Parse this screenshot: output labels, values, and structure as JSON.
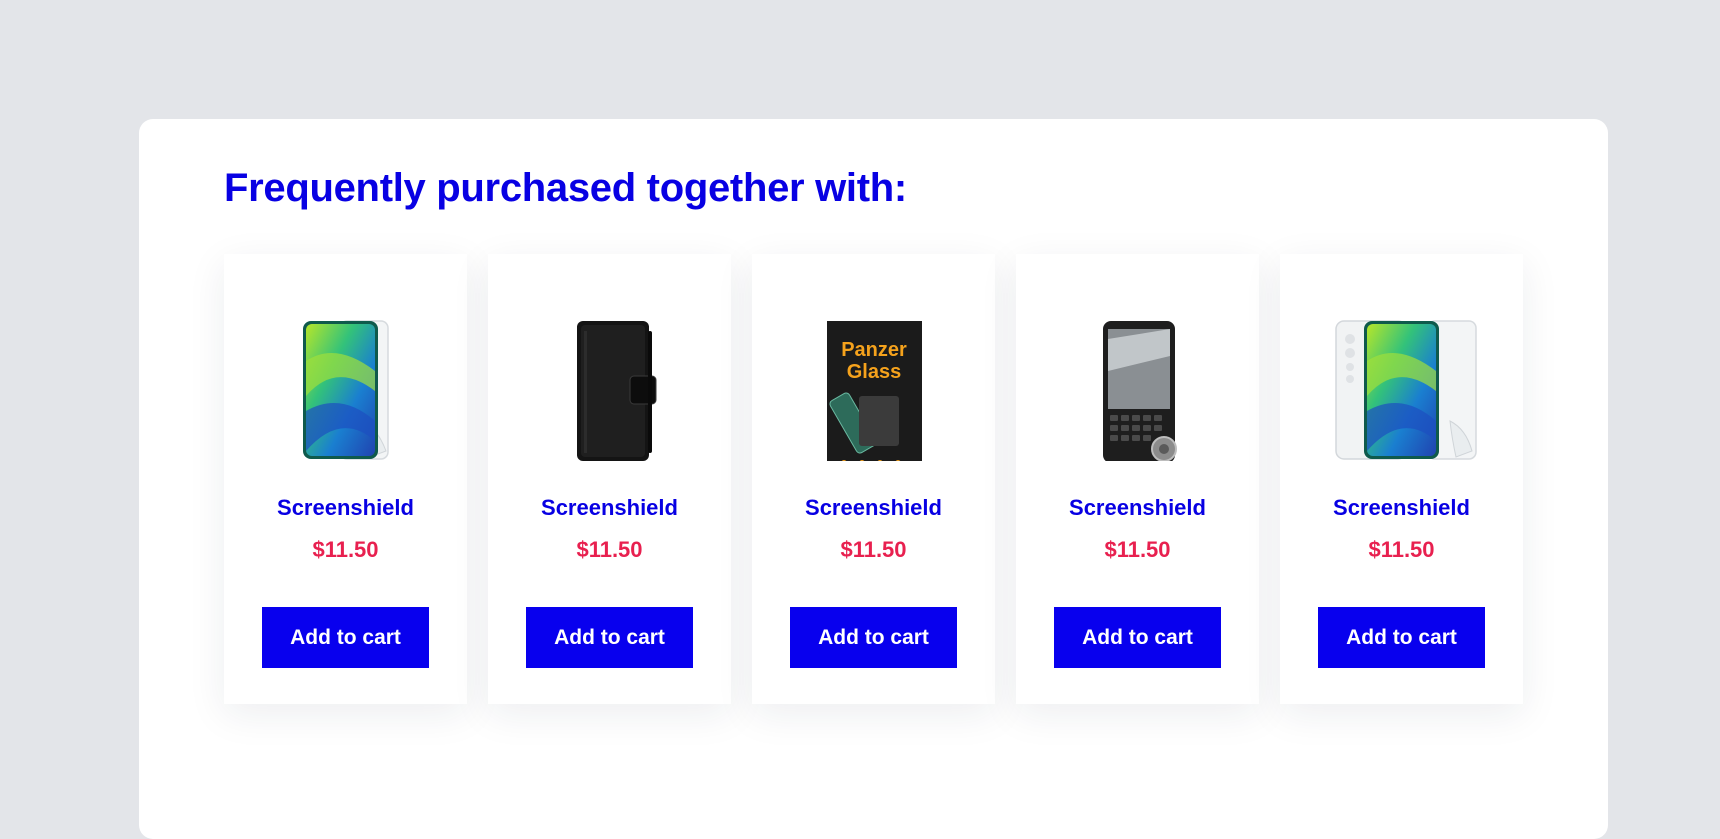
{
  "section": {
    "title": "Frequently purchased together with:"
  },
  "products": [
    {
      "name": "Screenshield",
      "price": "$11.50",
      "button_label": "Add to cart",
      "image": "phone-with-screen-protector-film"
    },
    {
      "name": "Screenshield",
      "price": "$11.50",
      "button_label": "Add to cart",
      "image": "black-flip-wallet-case"
    },
    {
      "name": "Screenshield",
      "price": "$11.50",
      "button_label": "Add to cart",
      "image": "panzerglass-package",
      "image_text": [
        "Panzer",
        "Glass"
      ]
    },
    {
      "name": "Screenshield",
      "price": "$11.50",
      "button_label": "Add to cart",
      "image": "keyboard-phone-with-protector"
    },
    {
      "name": "Screenshield",
      "price": "$11.50",
      "button_label": "Add to cart",
      "image": "phone-full-body-protector-film"
    }
  ],
  "colors": {
    "page_background": "#e3e5e9",
    "title": "#0800e3",
    "price": "#e8204f",
    "button": "#0800ee",
    "button_text": "#ffffff"
  }
}
